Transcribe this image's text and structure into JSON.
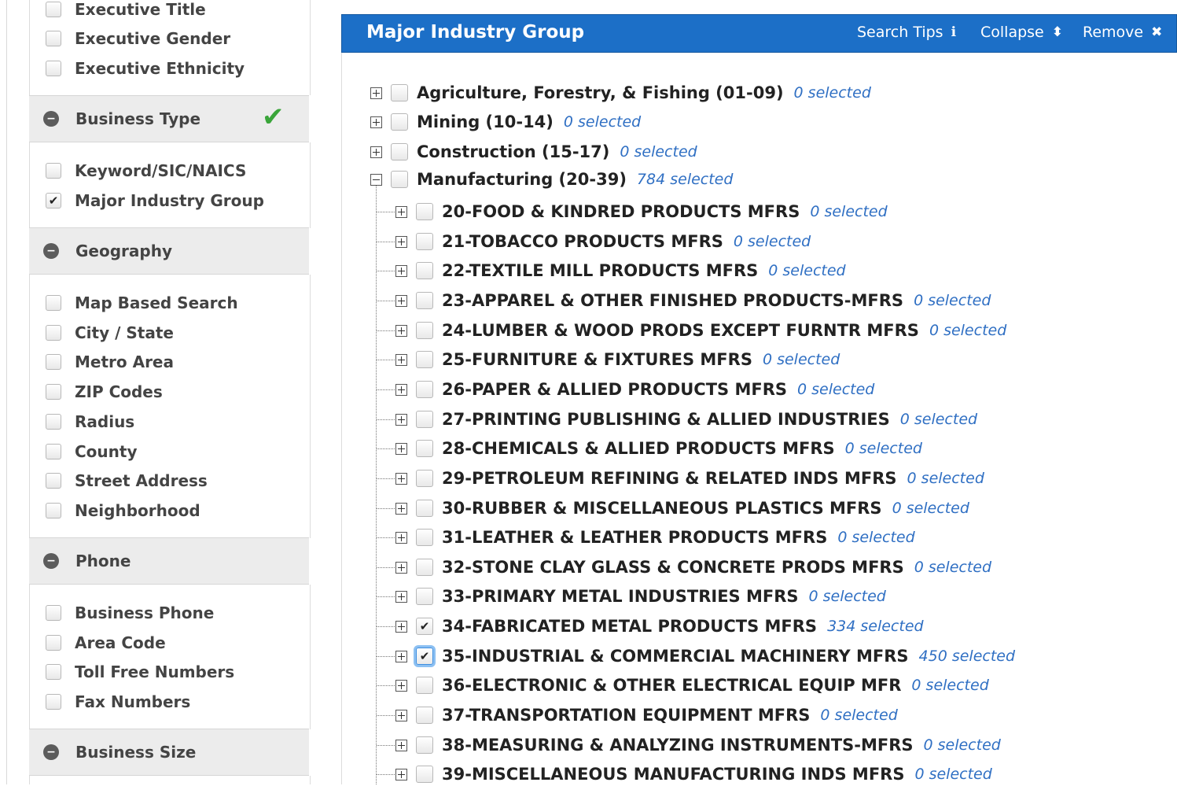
{
  "sidebar": {
    "executive_items": [
      {
        "label": "Executive Title",
        "checked": false
      },
      {
        "label": "Executive Gender",
        "checked": false
      },
      {
        "label": "Executive Ethnicity",
        "checked": false
      }
    ],
    "business_type": {
      "title": "Business Type",
      "complete": true,
      "items": [
        {
          "label": "Keyword/SIC/NAICS",
          "checked": false
        },
        {
          "label": "Major Industry Group",
          "checked": true
        }
      ]
    },
    "geography": {
      "title": "Geography",
      "items": [
        {
          "label": "Map Based Search",
          "checked": false
        },
        {
          "label": "City / State",
          "checked": false
        },
        {
          "label": "Metro Area",
          "checked": false
        },
        {
          "label": "ZIP Codes",
          "checked": false
        },
        {
          "label": "Radius",
          "checked": false
        },
        {
          "label": "County",
          "checked": false
        },
        {
          "label": "Street Address",
          "checked": false
        },
        {
          "label": "Neighborhood",
          "checked": false
        }
      ]
    },
    "phone": {
      "title": "Phone",
      "items": [
        {
          "label": "Business Phone",
          "checked": false
        },
        {
          "label": "Area Code",
          "checked": false
        },
        {
          "label": "Toll Free Numbers",
          "checked": false
        },
        {
          "label": "Fax Numbers",
          "checked": false
        }
      ]
    },
    "business_size": {
      "title": "Business Size"
    }
  },
  "panel": {
    "title": "Major Industry Group",
    "search_tips_label": "Search Tips",
    "collapse_label": "Collapse",
    "remove_label": "Remove"
  },
  "tree": {
    "top": [
      {
        "label": "Agriculture, Forestry, & Fishing (01-09)",
        "count": "0 selected",
        "expanded": false,
        "checked": false
      },
      {
        "label": "Mining (10-14)",
        "count": "0 selected",
        "expanded": false,
        "checked": false
      },
      {
        "label": "Construction (15-17)",
        "count": "0 selected",
        "expanded": false,
        "checked": false
      },
      {
        "label": "Manufacturing (20-39)",
        "count": "784 selected",
        "expanded": true,
        "checked": false
      }
    ],
    "manufacturing_children": [
      {
        "label": "20-FOOD & KINDRED PRODUCTS MFRS",
        "count": "0 selected",
        "checked": false
      },
      {
        "label": "21-TOBACCO PRODUCTS MFRS",
        "count": "0 selected",
        "checked": false
      },
      {
        "label": "22-TEXTILE MILL PRODUCTS MFRS",
        "count": "0 selected",
        "checked": false
      },
      {
        "label": "23-APPAREL & OTHER FINISHED PRODUCTS-MFRS",
        "count": "0 selected",
        "checked": false
      },
      {
        "label": "24-LUMBER & WOOD PRODS EXCEPT FURNTR MFRS",
        "count": "0 selected",
        "checked": false
      },
      {
        "label": "25-FURNITURE & FIXTURES MFRS",
        "count": "0 selected",
        "checked": false
      },
      {
        "label": "26-PAPER & ALLIED PRODUCTS MFRS",
        "count": "0 selected",
        "checked": false
      },
      {
        "label": "27-PRINTING PUBLISHING & ALLIED INDUSTRIES",
        "count": "0 selected",
        "checked": false
      },
      {
        "label": "28-CHEMICALS & ALLIED PRODUCTS MFRS",
        "count": "0 selected",
        "checked": false
      },
      {
        "label": "29-PETROLEUM REFINING & RELATED INDS MFRS",
        "count": "0 selected",
        "checked": false
      },
      {
        "label": "30-RUBBER & MISCELLANEOUS PLASTICS MFRS",
        "count": "0 selected",
        "checked": false
      },
      {
        "label": "31-LEATHER & LEATHER PRODUCTS MFRS",
        "count": "0 selected",
        "checked": false
      },
      {
        "label": "32-STONE CLAY GLASS & CONCRETE PRODS MFRS",
        "count": "0 selected",
        "checked": false
      },
      {
        "label": "33-PRIMARY METAL INDUSTRIES MFRS",
        "count": "0 selected",
        "checked": false
      },
      {
        "label": "34-FABRICATED METAL PRODUCTS MFRS",
        "count": "334 selected",
        "checked": true
      },
      {
        "label": "35-INDUSTRIAL & COMMERCIAL MACHINERY MFRS",
        "count": "450 selected",
        "checked": true,
        "focused": true
      },
      {
        "label": "36-ELECTRONIC & OTHER ELECTRICAL EQUIP MFR",
        "count": "0 selected",
        "checked": false
      },
      {
        "label": "37-TRANSPORTATION EQUIPMENT MFRS",
        "count": "0 selected",
        "checked": false
      },
      {
        "label": "38-MEASURING & ANALYZING INSTRUMENTS-MFRS",
        "count": "0 selected",
        "checked": false
      },
      {
        "label": "39-MISCELLANEOUS MANUFACTURING INDS MFRS",
        "count": "0 selected",
        "checked": false
      }
    ]
  },
  "colors": {
    "header_blue": "#1c6fc7",
    "count_blue": "#2f6fc3",
    "complete_green": "#3aa53a"
  }
}
